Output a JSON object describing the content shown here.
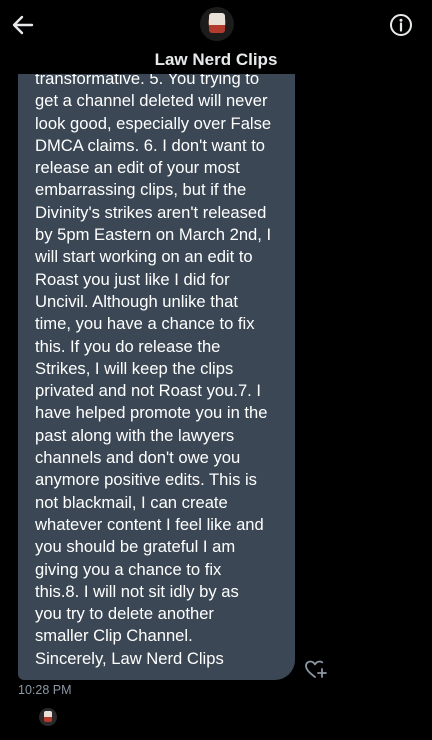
{
  "header": {
    "title": "Law Nerd Clips",
    "back_icon": "arrow-left-icon",
    "info_icon": "info-icon"
  },
  "message": {
    "text": "transformative. 5. You trying to\nget a channel deleted will never\nlook good, especially over False\nDMCA claims. 6. I don't want to\nrelease an edit of your most\nembarrassing clips, but if the\nDivinity's strikes aren't released\nby 5pm Eastern on March 2nd, I\nwill start working on an edit to\nRoast you just like I did for\nUncivil. Although unlike that\ntime, you have a chance to fix\nthis. If you do release the\nStrikes, I will keep the clips\nprivated and not Roast you.7. I\nhave helped promote you in the\npast along with the lawyers\nchannels and don't owe you\nanymore positive edits. This is\nnot blackmail, I can create\nwhatever content I feel like and\nyou should be grateful I am\ngiving you a chance to fix\nthis.8. I will not sit idly by as\nyou try to delete another\nsmaller Clip Channel.\nSincerely,  Law Nerd Clips",
    "timestamp": "10:28 PM",
    "react_icon": "heart-plus-icon",
    "bubble_color": "#3b4754"
  }
}
